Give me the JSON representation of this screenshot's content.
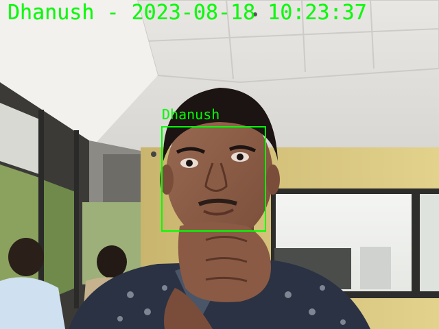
{
  "overlay": {
    "caption": "Dhanush - 2023-08-18 10:23:37",
    "face_label": "Dhanush",
    "color": "#00ff00"
  }
}
